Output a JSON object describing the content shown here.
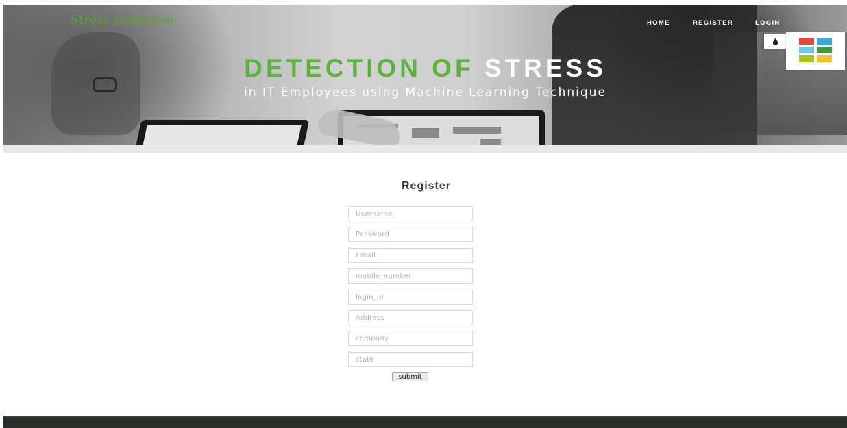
{
  "header": {
    "brand": "Stress Detection",
    "nav": [
      {
        "label": "HOME"
      },
      {
        "label": "REGISTER"
      },
      {
        "label": "LOGIN"
      }
    ]
  },
  "hero": {
    "title_green": "DETECTION OF",
    "title_white": "STRESS",
    "subtitle": "in IT Employees using Machine Learning Technique"
  },
  "style_switcher": {
    "toggle_icon": "droplet-icon",
    "swatches": [
      "#e8453c",
      "#3da6de",
      "#6ccbe6",
      "#3f9a3c",
      "#a6c81c",
      "#f2c12e"
    ]
  },
  "form": {
    "title": "Register",
    "fields": [
      {
        "placeholder": "Username"
      },
      {
        "placeholder": "Password"
      },
      {
        "placeholder": "Email"
      },
      {
        "placeholder": "mobile_number"
      },
      {
        "placeholder": "login_id"
      },
      {
        "placeholder": "Address"
      },
      {
        "placeholder": "company"
      },
      {
        "placeholder": "state"
      }
    ],
    "submit_label": "submit"
  },
  "colors": {
    "brand_green": "#5ab43c",
    "footer_bg": "#2b2f2b"
  }
}
